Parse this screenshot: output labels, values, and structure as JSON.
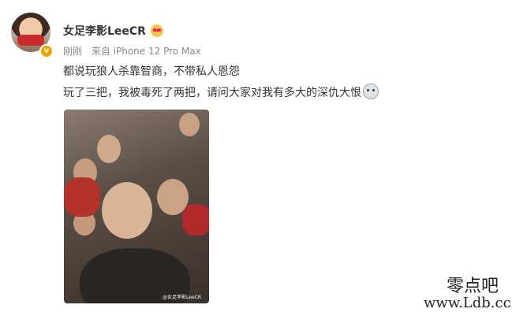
{
  "post": {
    "username": "女足李影LeeCR",
    "time": "刚刚",
    "source": "来自 iPhone 12 Pro Max",
    "line1": "都说玩狼人杀靠智商，不带私人恩怨",
    "line2": "玩了三把，我被毒死了两把，请问大家对我有多大的深仇大恨",
    "photo_watermark": "@女足李影LeeCR",
    "verify_badge": "v"
  },
  "watermark": {
    "site_name": "零点吧",
    "site_url": "www.Ldb.cc"
  },
  "icons": {
    "verified": "verified-v-icon",
    "vip": "heart-eyes-emoji-icon",
    "emoji": "shocked-face-emoji-icon"
  }
}
